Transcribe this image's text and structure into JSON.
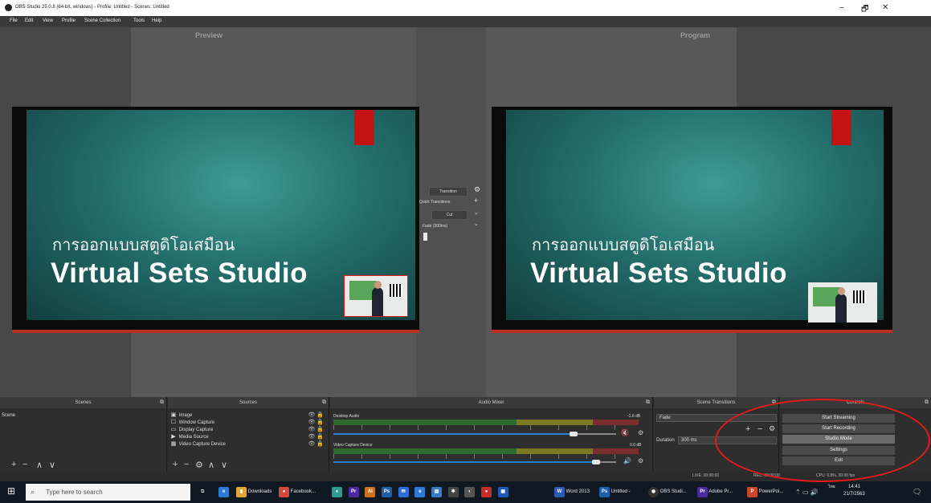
{
  "window": {
    "title": "OBS Studio 25.0.8 (64-bit, windows) - Profile: Untitled - Scenes: Untitled",
    "minimize": "–",
    "maximize": "🗗",
    "close": "✕"
  },
  "menu": [
    "File",
    "Edit",
    "View",
    "Profile",
    "Scene Collection",
    "Tools",
    "Help"
  ],
  "preview": {
    "label": "Preview",
    "thai_text": "การออกแบบสตูดิโอเสมือน",
    "title_text": "Virtual Sets Studio"
  },
  "program": {
    "label": "Program",
    "thai_text": "การออกแบบสตูดิโอเสมือน",
    "title_text": "Virtual Sets Studio"
  },
  "transition_controls": {
    "transition_button": "Transition",
    "quick_transitions": "Quick Transitions",
    "cut": "Cut",
    "fade": "Fade (300ms)"
  },
  "scenes": {
    "title": "Scenes",
    "items": [
      "Scene"
    ]
  },
  "sources": {
    "title": "Sources",
    "items": [
      {
        "icon": "image-icon",
        "label": "Image",
        "glyph": "▣"
      },
      {
        "icon": "window-capture-icon",
        "label": "Window Capture",
        "glyph": "☐"
      },
      {
        "icon": "display-capture-icon",
        "label": "Display Capture",
        "glyph": "▭"
      },
      {
        "icon": "media-source-icon",
        "label": "Media Source",
        "glyph": "▶"
      },
      {
        "icon": "video-capture-icon",
        "label": "Video Capture Device",
        "glyph": "▦"
      }
    ]
  },
  "audio_mixer": {
    "title": "Audio Mixer",
    "channels": [
      {
        "name": "Desktop Audio",
        "db": "-1.6 dB",
        "muted": true,
        "level": 0.85
      },
      {
        "name": "Video Capture Device",
        "db": "0.0 dB",
        "muted": false,
        "level": 0.93
      }
    ]
  },
  "scene_transitions": {
    "title": "Scene Transitions",
    "selected": "Fade",
    "duration_label": "Duration",
    "duration_value": "300 ms"
  },
  "controls": {
    "title": "Controls",
    "buttons": [
      "Start Streaming",
      "Start Recording",
      "Studio Mode",
      "Settings",
      "Exit"
    ],
    "active": "Studio Mode"
  },
  "status": {
    "live": "LIVE: 00:00:00",
    "rec": "REC: 00:00:00",
    "cpu": "CPU: 0.8%, 30.00 fps"
  },
  "taskbar": {
    "search_placeholder": "Type here to search",
    "items": [
      {
        "label": "Downloads",
        "icon": "folder-icon",
        "color": "#e1a53a",
        "glyph": "▮"
      },
      {
        "label": "Facebook...",
        "icon": "chrome-icon",
        "color": "#d24a3a",
        "glyph": "●"
      },
      {
        "label": "Word 2013",
        "icon": "word-icon",
        "color": "#2b5bb5",
        "glyph": "W"
      },
      {
        "label": "Untitled -",
        "icon": "photoshop-icon",
        "color": "#1f5ea8",
        "glyph": "Ps"
      },
      {
        "label": "OBS Studi...",
        "icon": "obs-icon",
        "color": "#333333",
        "glyph": "◉"
      },
      {
        "label": "Adobe Pr...",
        "icon": "premiere-icon",
        "color": "#4b2aa0",
        "glyph": "Pr"
      },
      {
        "label": "PowerPoi...",
        "icon": "powerpoint-icon",
        "color": "#c8472a",
        "glyph": "P"
      }
    ],
    "time": "14:41",
    "date": "21/7/2563",
    "lang": "ไทย"
  }
}
